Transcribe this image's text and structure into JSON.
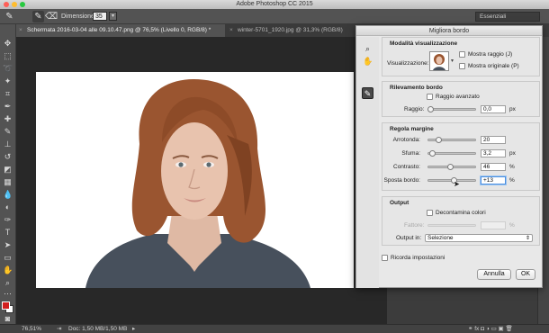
{
  "app": {
    "title": "Adobe Photoshop CC 2015"
  },
  "options_bar": {
    "size_label": "Dimensione:",
    "size_value": "35",
    "workspace": "Essenziali"
  },
  "tabs": [
    {
      "label": "Schermata 2016-03-04 alle 09.10.47.png @ 76,5% (Livello 0, RGB/8) *",
      "active": true
    },
    {
      "label": "winter-5701_1920.jpg @ 31,3% (RGB/8)",
      "active": false
    }
  ],
  "status": {
    "zoom": "76,51%",
    "doc": "Doc: 1,50 MB/1,50 MB"
  },
  "dialog": {
    "title": "Migliora bordo",
    "view_mode": {
      "title": "Modalità visualizzazione",
      "view_label": "Visualizzazione:",
      "show_radius": "Mostra raggio (J)",
      "show_original": "Mostra originale (P)"
    },
    "edge_detection": {
      "title": "Rilevamento bordo",
      "smart_radius": "Raggio avanzato",
      "radius_label": "Raggio:",
      "radius_value": "0,0",
      "radius_unit": "px",
      "radius_level": 0.0
    },
    "adjust_edge": {
      "title": "Regola margine",
      "rows": [
        {
          "label": "Arrotonda:",
          "value": "20",
          "unit": "",
          "level": 0.2
        },
        {
          "label": "Sfuma:",
          "value": "3,2",
          "unit": "px",
          "level": 0.05
        },
        {
          "label": "Contrasto:",
          "value": "46",
          "unit": "%",
          "level": 0.46
        },
        {
          "label": "Sposta bordo:",
          "value": "+13",
          "unit": "%",
          "level": 0.56
        }
      ]
    },
    "output": {
      "title": "Output",
      "decontaminate": "Decontamina colori",
      "amount_label": "Fattore:",
      "amount_unit": "%",
      "output_to_label": "Output in:",
      "output_to_value": "Selezione"
    },
    "remember": "Ricorda impostazioni",
    "cancel": "Annulla",
    "ok": "OK"
  }
}
